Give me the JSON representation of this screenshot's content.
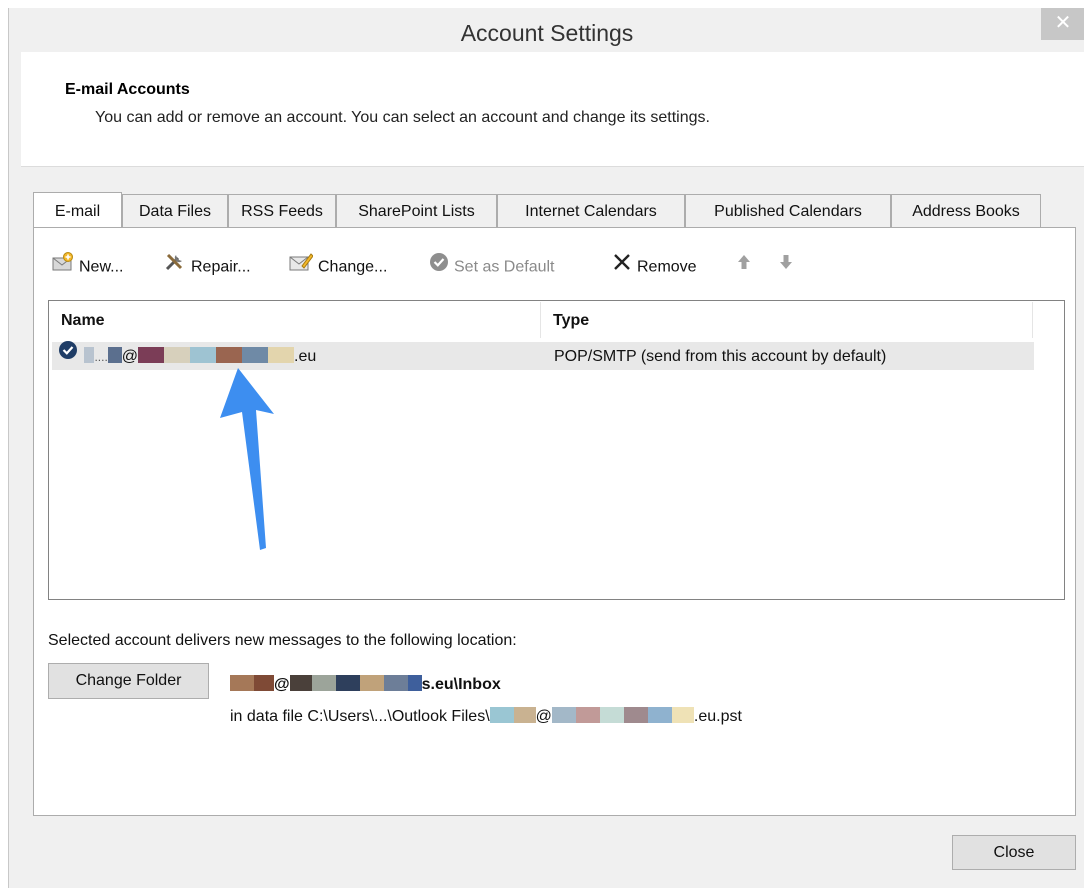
{
  "window": {
    "title": "Account Settings",
    "close_glyph": "✕"
  },
  "header": {
    "title": "E-mail Accounts",
    "subtitle": "You can add or remove an account. You can select an account and change its settings."
  },
  "tabs": [
    {
      "label": "E-mail",
      "active": true
    },
    {
      "label": "Data Files"
    },
    {
      "label": "RSS Feeds"
    },
    {
      "label": "SharePoint Lists"
    },
    {
      "label": "Internet Calendars"
    },
    {
      "label": "Published Calendars"
    },
    {
      "label": "Address Books"
    }
  ],
  "toolbar": {
    "new_label": "New...",
    "repair_label": "Repair...",
    "change_label": "Change...",
    "set_default_label": "Set as Default",
    "remove_label": "Remove"
  },
  "list": {
    "columns": {
      "name": "Name",
      "type": "Type"
    },
    "rows": [
      {
        "name_prefix": "....",
        "at": "@",
        "domain_suffix": ".eu",
        "type": "POP/SMTP (send from this account by default)"
      }
    ]
  },
  "location": {
    "label": "Selected account delivers new messages to the following location:",
    "change_folder_label": "Change Folder",
    "folder_at": "@",
    "folder_suffix": "s.eu\\Inbox",
    "datafile_prefix": "in data file C:\\Users\\...\\Outlook Files\\",
    "datafile_at": "@",
    "datafile_suffix": ".eu.pst"
  },
  "footer": {
    "close_label": "Close"
  },
  "colors": {
    "accent_arrow": "#3d8ef0",
    "default_check": "#1f3d66"
  }
}
